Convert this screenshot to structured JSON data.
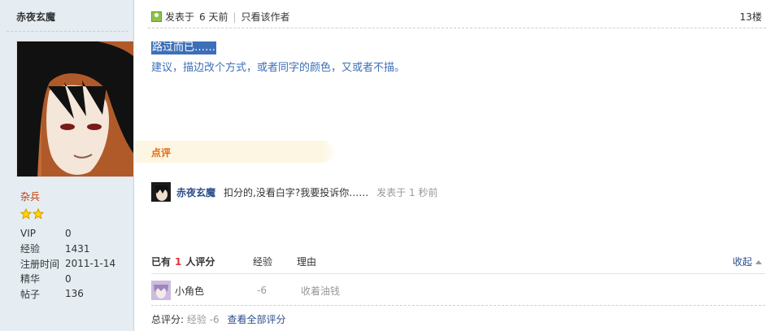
{
  "sidebar": {
    "username": "赤夜玄魔",
    "rank": "杂兵",
    "stats": [
      {
        "label": "VIP",
        "value": "0"
      },
      {
        "label": "经验",
        "value": "1431"
      },
      {
        "label": "注册时间",
        "value": "2011-1-14"
      },
      {
        "label": "精华",
        "value": "0"
      },
      {
        "label": "帖子",
        "value": "136"
      }
    ]
  },
  "post": {
    "posted_label": "发表于",
    "posted_time": "6 天前",
    "author_only": "只看该作者",
    "floor": "13楼",
    "line1": "路过而已……",
    "line2": "建议，描边改个方式，或者同字的颜色，又或者不描。"
  },
  "comments": {
    "label": "点评",
    "user": "赤夜玄魔",
    "text": "扣分的,没看白字?我要投诉你……",
    "time": "发表于 1 秒前"
  },
  "rating": {
    "prefix": "已有",
    "count": "1",
    "suffix": "人评分",
    "col_exp": "经验",
    "col_reason": "理由",
    "collapse": "收起",
    "row_user": "小角色",
    "row_score": "-6",
    "row_reason": "收着油钱",
    "total_label": "总评分:",
    "total_value": "经验 -6",
    "view_all": "查看全部评分"
  },
  "colors": {
    "link": "#2b4e8c",
    "highlight": "#3d6fb9",
    "rank": "#cc3300"
  }
}
